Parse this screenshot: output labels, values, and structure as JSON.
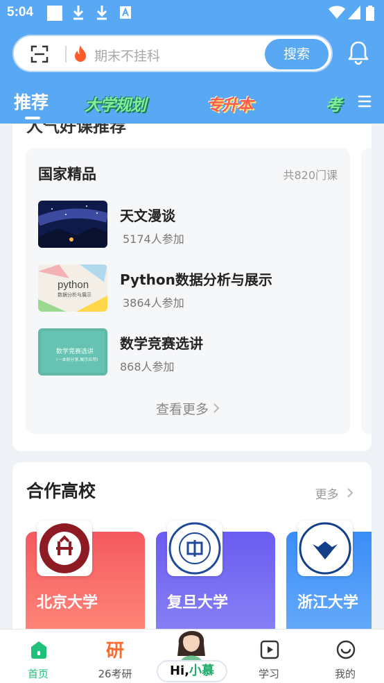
{
  "status_bar": {
    "time": "5:04"
  },
  "search": {
    "placeholder": "期末不挂科",
    "button_label": "搜索"
  },
  "tabs": {
    "recommend": "推荐",
    "plan": "大学规划",
    "upgrade": "专升本",
    "exam": "考"
  },
  "colors": {
    "header_blue": "#58a8f3",
    "accent_green": "#20c17a",
    "orange": "#ff6a2c"
  },
  "featured": {
    "section_title": "人气好课推荐",
    "panel_title": "国家精品",
    "course_count": "共820门课",
    "courses": [
      {
        "name": "天文漫谈",
        "participants": "5174人参加",
        "thumb": "starry-night"
      },
      {
        "name": "Python数据分析与展示",
        "participants": "3864人参加",
        "thumb": "python",
        "thumb_text": "python",
        "thumb_subtext": "数据分析与展示"
      },
      {
        "name": "数学竞赛选讲",
        "participants": "868人参加",
        "thumb": "math",
        "thumb_text": "数学竞赛选讲",
        "thumb_subtext": "(一本册分享,展示应用)"
      }
    ],
    "more_label": "查看更多"
  },
  "partners": {
    "title": "合作高校",
    "more_label": "更多",
    "universities": [
      {
        "name": "北京大学",
        "color": "#f44f55"
      },
      {
        "name": "复旦大学",
        "color": "#6e63ee"
      },
      {
        "name": "浙江大学",
        "color": "#3d8ef8"
      }
    ]
  },
  "bottom_nav": {
    "home": "首页",
    "kaoyan_glyph": "研",
    "kaoyan": "26考研",
    "assistant_hi": "Hi,",
    "assistant_name": "小慕",
    "study": "学习",
    "mine": "我的"
  }
}
